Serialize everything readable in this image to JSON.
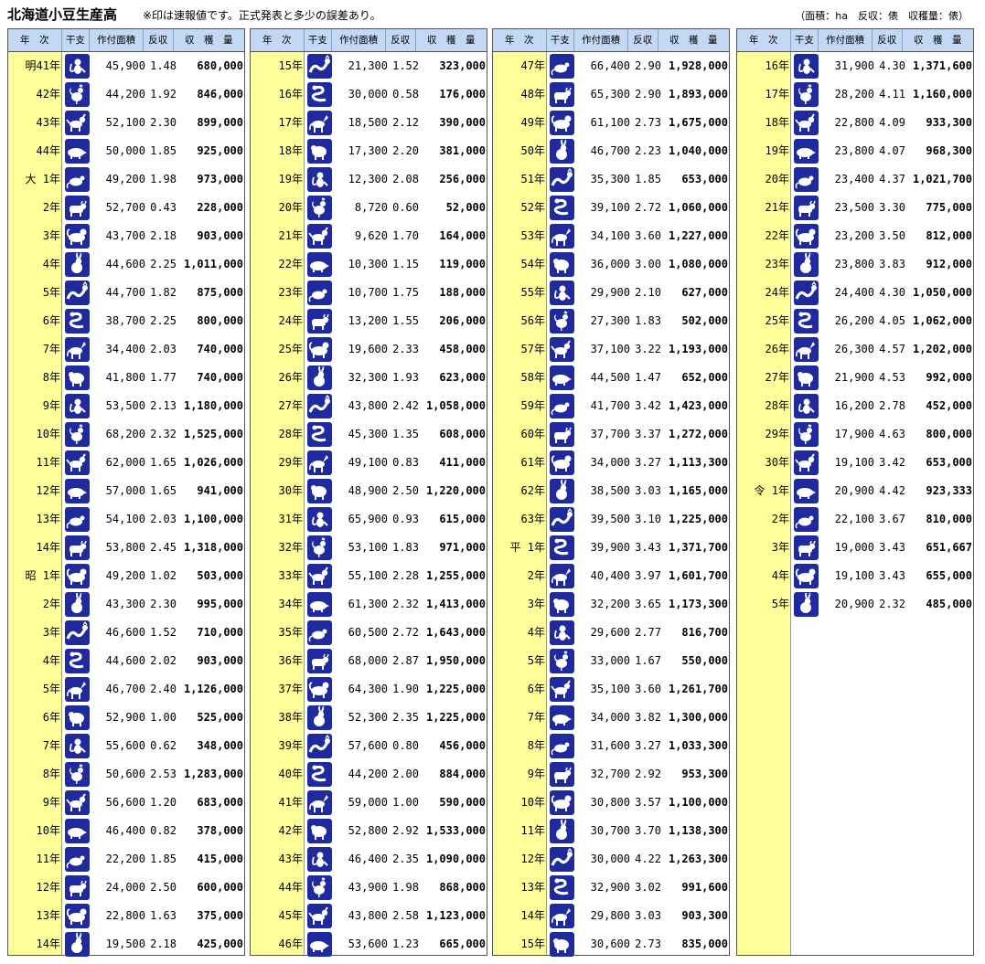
{
  "title": "北海道小豆生産高",
  "note": "※印は速報値です。正式発表と多少の誤差あり。",
  "units": "（面積：ha　反収：俵　収穫量：俵）",
  "headers": [
    "年　次",
    "干支",
    "作付面積",
    "反収",
    "収　穫　量"
  ],
  "zodiac_icons": [
    "rat-icon",
    "ox-icon",
    "tiger-icon",
    "rabbit-icon",
    "dragon-icon",
    "snake-icon",
    "horse-icon",
    "sheep-icon",
    "monkey-icon",
    "rooster-icon",
    "dog-icon",
    "boar-icon"
  ],
  "columns": [
    [
      {
        "y": "明41年",
        "a": "45,900",
        "r": "1.48",
        "p": "680,000",
        "z": 8
      },
      {
        "y": "42年",
        "a": "44,200",
        "r": "1.92",
        "p": "846,000",
        "z": 9
      },
      {
        "y": "43年",
        "a": "52,100",
        "r": "2.30",
        "p": "899,000",
        "z": 10
      },
      {
        "y": "44年",
        "a": "50,000",
        "r": "1.85",
        "p": "925,000",
        "z": 11
      },
      {
        "y": "大 1年",
        "a": "49,200",
        "r": "1.98",
        "p": "973,000",
        "z": 0
      },
      {
        "y": "2年",
        "a": "52,700",
        "r": "0.43",
        "p": "228,000",
        "z": 1
      },
      {
        "y": "3年",
        "a": "43,700",
        "r": "2.18",
        "p": "903,000",
        "z": 2
      },
      {
        "y": "4年",
        "a": "44,600",
        "r": "2.25",
        "p": "1,011,000",
        "z": 3
      },
      {
        "y": "5年",
        "a": "44,700",
        "r": "1.82",
        "p": "875,000",
        "z": 4
      },
      {
        "y": "6年",
        "a": "38,700",
        "r": "2.25",
        "p": "800,000",
        "z": 5
      },
      {
        "y": "7年",
        "a": "34,400",
        "r": "2.03",
        "p": "740,000",
        "z": 6
      },
      {
        "y": "8年",
        "a": "41,800",
        "r": "1.77",
        "p": "740,000",
        "z": 7
      },
      {
        "y": "9年",
        "a": "53,500",
        "r": "2.13",
        "p": "1,180,000",
        "z": 8
      },
      {
        "y": "10年",
        "a": "68,200",
        "r": "2.32",
        "p": "1,525,000",
        "z": 9
      },
      {
        "y": "11年",
        "a": "62,000",
        "r": "1.65",
        "p": "1,026,000",
        "z": 10
      },
      {
        "y": "12年",
        "a": "57,000",
        "r": "1.65",
        "p": "941,000",
        "z": 11
      },
      {
        "y": "13年",
        "a": "54,100",
        "r": "2.03",
        "p": "1,100,000",
        "z": 0
      },
      {
        "y": "14年",
        "a": "53,800",
        "r": "2.45",
        "p": "1,318,000",
        "z": 1
      },
      {
        "y": "昭 1年",
        "a": "49,200",
        "r": "1.02",
        "p": "503,000",
        "z": 2
      },
      {
        "y": "2年",
        "a": "43,300",
        "r": "2.30",
        "p": "995,000",
        "z": 3
      },
      {
        "y": "3年",
        "a": "46,600",
        "r": "1.52",
        "p": "710,000",
        "z": 4
      },
      {
        "y": "4年",
        "a": "44,600",
        "r": "2.02",
        "p": "903,000",
        "z": 5
      },
      {
        "y": "5年",
        "a": "46,700",
        "r": "2.40",
        "p": "1,126,000",
        "z": 6
      },
      {
        "y": "6年",
        "a": "52,900",
        "r": "1.00",
        "p": "525,000",
        "z": 7
      },
      {
        "y": "7年",
        "a": "55,600",
        "r": "0.62",
        "p": "348,000",
        "z": 8
      },
      {
        "y": "8年",
        "a": "50,600",
        "r": "2.53",
        "p": "1,283,000",
        "z": 9
      },
      {
        "y": "9年",
        "a": "56,600",
        "r": "1.20",
        "p": "683,000",
        "z": 10
      },
      {
        "y": "10年",
        "a": "46,400",
        "r": "0.82",
        "p": "378,000",
        "z": 11
      },
      {
        "y": "11年",
        "a": "22,200",
        "r": "1.85",
        "p": "415,000",
        "z": 0
      },
      {
        "y": "12年",
        "a": "24,000",
        "r": "2.50",
        "p": "600,000",
        "z": 1
      },
      {
        "y": "13年",
        "a": "22,800",
        "r": "1.63",
        "p": "375,000",
        "z": 2
      },
      {
        "y": "14年",
        "a": "19,500",
        "r": "2.18",
        "p": "425,000",
        "z": 3
      }
    ],
    [
      {
        "y": "15年",
        "a": "21,300",
        "r": "1.52",
        "p": "323,000",
        "z": 4
      },
      {
        "y": "16年",
        "a": "30,000",
        "r": "0.58",
        "p": "176,000",
        "z": 5
      },
      {
        "y": "17年",
        "a": "18,500",
        "r": "2.12",
        "p": "390,000",
        "z": 6
      },
      {
        "y": "18年",
        "a": "17,300",
        "r": "2.20",
        "p": "381,000",
        "z": 7
      },
      {
        "y": "19年",
        "a": "12,300",
        "r": "2.08",
        "p": "256,000",
        "z": 8
      },
      {
        "y": "20年",
        "a": "8,720",
        "r": "0.60",
        "p": "52,000",
        "z": 9
      },
      {
        "y": "21年",
        "a": "9,620",
        "r": "1.70",
        "p": "164,000",
        "z": 10
      },
      {
        "y": "22年",
        "a": "10,300",
        "r": "1.15",
        "p": "119,000",
        "z": 11
      },
      {
        "y": "23年",
        "a": "10,700",
        "r": "1.75",
        "p": "188,000",
        "z": 0
      },
      {
        "y": "24年",
        "a": "13,200",
        "r": "1.55",
        "p": "206,000",
        "z": 1
      },
      {
        "y": "25年",
        "a": "19,600",
        "r": "2.33",
        "p": "458,000",
        "z": 2
      },
      {
        "y": "26年",
        "a": "32,300",
        "r": "1.93",
        "p": "623,000",
        "z": 3
      },
      {
        "y": "27年",
        "a": "43,800",
        "r": "2.42",
        "p": "1,058,000",
        "z": 4
      },
      {
        "y": "28年",
        "a": "45,300",
        "r": "1.35",
        "p": "608,000",
        "z": 5
      },
      {
        "y": "29年",
        "a": "49,100",
        "r": "0.83",
        "p": "411,000",
        "z": 6
      },
      {
        "y": "30年",
        "a": "48,900",
        "r": "2.50",
        "p": "1,220,000",
        "z": 7
      },
      {
        "y": "31年",
        "a": "65,900",
        "r": "0.93",
        "p": "615,000",
        "z": 8
      },
      {
        "y": "32年",
        "a": "53,100",
        "r": "1.83",
        "p": "971,000",
        "z": 9
      },
      {
        "y": "33年",
        "a": "55,100",
        "r": "2.28",
        "p": "1,255,000",
        "z": 10
      },
      {
        "y": "34年",
        "a": "61,300",
        "r": "2.32",
        "p": "1,413,000",
        "z": 11
      },
      {
        "y": "35年",
        "a": "60,500",
        "r": "2.72",
        "p": "1,643,000",
        "z": 0
      },
      {
        "y": "36年",
        "a": "68,000",
        "r": "2.87",
        "p": "1,950,000",
        "z": 1
      },
      {
        "y": "37年",
        "a": "64,300",
        "r": "1.90",
        "p": "1,225,000",
        "z": 2
      },
      {
        "y": "38年",
        "a": "52,300",
        "r": "2.35",
        "p": "1,225,000",
        "z": 3
      },
      {
        "y": "39年",
        "a": "57,600",
        "r": "0.80",
        "p": "456,000",
        "z": 4
      },
      {
        "y": "40年",
        "a": "44,200",
        "r": "2.00",
        "p": "884,000",
        "z": 5
      },
      {
        "y": "41年",
        "a": "59,000",
        "r": "1.00",
        "p": "590,000",
        "z": 6
      },
      {
        "y": "42年",
        "a": "52,800",
        "r": "2.92",
        "p": "1,533,000",
        "z": 7
      },
      {
        "y": "43年",
        "a": "46,400",
        "r": "2.35",
        "p": "1,090,000",
        "z": 8
      },
      {
        "y": "44年",
        "a": "43,900",
        "r": "1.98",
        "p": "868,000",
        "z": 9
      },
      {
        "y": "45年",
        "a": "43,800",
        "r": "2.58",
        "p": "1,123,000",
        "z": 10
      },
      {
        "y": "46年",
        "a": "53,600",
        "r": "1.23",
        "p": "665,000",
        "z": 11
      }
    ],
    [
      {
        "y": "47年",
        "a": "66,400",
        "r": "2.90",
        "p": "1,928,000",
        "z": 0
      },
      {
        "y": "48年",
        "a": "65,300",
        "r": "2.90",
        "p": "1,893,000",
        "z": 1
      },
      {
        "y": "49年",
        "a": "61,100",
        "r": "2.73",
        "p": "1,675,000",
        "z": 2
      },
      {
        "y": "50年",
        "a": "46,700",
        "r": "2.23",
        "p": "1,040,000",
        "z": 3
      },
      {
        "y": "51年",
        "a": "35,300",
        "r": "1.85",
        "p": "653,000",
        "z": 4
      },
      {
        "y": "52年",
        "a": "39,100",
        "r": "2.72",
        "p": "1,060,000",
        "z": 5
      },
      {
        "y": "53年",
        "a": "34,100",
        "r": "3.60",
        "p": "1,227,000",
        "z": 6
      },
      {
        "y": "54年",
        "a": "36,000",
        "r": "3.00",
        "p": "1,080,000",
        "z": 7
      },
      {
        "y": "55年",
        "a": "29,900",
        "r": "2.10",
        "p": "627,000",
        "z": 8
      },
      {
        "y": "56年",
        "a": "27,300",
        "r": "1.83",
        "p": "502,000",
        "z": 9
      },
      {
        "y": "57年",
        "a": "37,100",
        "r": "3.22",
        "p": "1,193,000",
        "z": 10
      },
      {
        "y": "58年",
        "a": "44,500",
        "r": "1.47",
        "p": "652,000",
        "z": 11
      },
      {
        "y": "59年",
        "a": "41,700",
        "r": "3.42",
        "p": "1,423,000",
        "z": 0
      },
      {
        "y": "60年",
        "a": "37,700",
        "r": "3.37",
        "p": "1,272,000",
        "z": 1
      },
      {
        "y": "61年",
        "a": "34,000",
        "r": "3.27",
        "p": "1,113,300",
        "z": 2
      },
      {
        "y": "62年",
        "a": "38,500",
        "r": "3.03",
        "p": "1,165,000",
        "z": 3
      },
      {
        "y": "63年",
        "a": "39,500",
        "r": "3.10",
        "p": "1,225,000",
        "z": 4
      },
      {
        "y": "平 1年",
        "a": "39,900",
        "r": "3.43",
        "p": "1,371,700",
        "z": 5
      },
      {
        "y": "2年",
        "a": "40,400",
        "r": "3.97",
        "p": "1,601,700",
        "z": 6
      },
      {
        "y": "3年",
        "a": "32,200",
        "r": "3.65",
        "p": "1,173,300",
        "z": 7
      },
      {
        "y": "4年",
        "a": "29,600",
        "r": "2.77",
        "p": "816,700",
        "z": 8
      },
      {
        "y": "5年",
        "a": "33,000",
        "r": "1.67",
        "p": "550,000",
        "z": 9
      },
      {
        "y": "6年",
        "a": "35,100",
        "r": "3.60",
        "p": "1,261,700",
        "z": 10
      },
      {
        "y": "7年",
        "a": "34,000",
        "r": "3.82",
        "p": "1,300,000",
        "z": 11
      },
      {
        "y": "8年",
        "a": "31,600",
        "r": "3.27",
        "p": "1,033,300",
        "z": 0
      },
      {
        "y": "9年",
        "a": "32,700",
        "r": "2.92",
        "p": "953,300",
        "z": 1
      },
      {
        "y": "10年",
        "a": "30,800",
        "r": "3.57",
        "p": "1,100,000",
        "z": 2
      },
      {
        "y": "11年",
        "a": "30,700",
        "r": "3.70",
        "p": "1,138,300",
        "z": 3
      },
      {
        "y": "12年",
        "a": "30,000",
        "r": "4.22",
        "p": "1,263,300",
        "z": 4
      },
      {
        "y": "13年",
        "a": "32,900",
        "r": "3.02",
        "p": "991,600",
        "z": 5
      },
      {
        "y": "14年",
        "a": "29,800",
        "r": "3.03",
        "p": "903,300",
        "z": 6
      },
      {
        "y": "15年",
        "a": "30,600",
        "r": "2.73",
        "p": "835,000",
        "z": 7
      }
    ],
    [
      {
        "y": "16年",
        "a": "31,900",
        "r": "4.30",
        "p": "1,371,600",
        "z": 8
      },
      {
        "y": "17年",
        "a": "28,200",
        "r": "4.11",
        "p": "1,160,000",
        "z": 9
      },
      {
        "y": "18年",
        "a": "22,800",
        "r": "4.09",
        "p": "933,300",
        "z": 10
      },
      {
        "y": "19年",
        "a": "23,800",
        "r": "4.07",
        "p": "968,300",
        "z": 11
      },
      {
        "y": "20年",
        "a": "23,400",
        "r": "4.37",
        "p": "1,021,700",
        "z": 0
      },
      {
        "y": "21年",
        "a": "23,500",
        "r": "3.30",
        "p": "775,000",
        "z": 1
      },
      {
        "y": "22年",
        "a": "23,200",
        "r": "3.50",
        "p": "812,000",
        "z": 2
      },
      {
        "y": "23年",
        "a": "23,800",
        "r": "3.83",
        "p": "912,000",
        "z": 3
      },
      {
        "y": "24年",
        "a": "24,400",
        "r": "4.30",
        "p": "1,050,000",
        "z": 4
      },
      {
        "y": "25年",
        "a": "26,200",
        "r": "4.05",
        "p": "1,062,000",
        "z": 5
      },
      {
        "y": "26年",
        "a": "26,300",
        "r": "4.57",
        "p": "1,202,000",
        "z": 6
      },
      {
        "y": "27年",
        "a": "21,900",
        "r": "4.53",
        "p": "992,000",
        "z": 7
      },
      {
        "y": "28年",
        "a": "16,200",
        "r": "2.78",
        "p": "452,000",
        "z": 8
      },
      {
        "y": "29年",
        "a": "17,900",
        "r": "4.63",
        "p": "800,000",
        "z": 9
      },
      {
        "y": "30年",
        "a": "19,100",
        "r": "3.42",
        "p": "653,000",
        "z": 10
      },
      {
        "y": "令 1年",
        "a": "20,900",
        "r": "4.42",
        "p": "923,333",
        "z": 11
      },
      {
        "y": "2年",
        "a": "22,100",
        "r": "3.67",
        "p": "810,000",
        "z": 0
      },
      {
        "y": "3年",
        "a": "19,000",
        "r": "3.43",
        "p": "651,667",
        "z": 1
      },
      {
        "y": "4年",
        "a": "19,100",
        "r": "3.43",
        "p": "655,000",
        "z": 2
      },
      {
        "y": "5年",
        "a": "20,900",
        "r": "2.32",
        "p": "485,000",
        "z": 3
      }
    ]
  ]
}
